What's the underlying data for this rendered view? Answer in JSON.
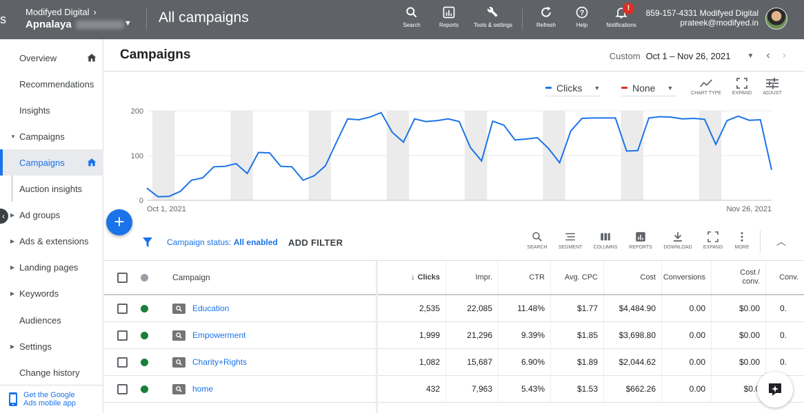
{
  "topbar": {
    "account_line1": "Modifyed Digital",
    "account_line2": "Apnalaya",
    "page_title": "All campaigns",
    "tools": [
      {
        "label": "Search",
        "icon": "search-icon"
      },
      {
        "label": "Reports",
        "icon": "reports-icon"
      },
      {
        "label": "Tools & settings",
        "icon": "wrench-icon"
      },
      {
        "label": "Refresh",
        "icon": "refresh-icon"
      },
      {
        "label": "Help",
        "icon": "help-icon"
      },
      {
        "label": "Notifications",
        "icon": "bell-icon",
        "badge": "!"
      }
    ],
    "user_line1": "859-157-4331 Modifyed Digital",
    "user_line2": "prateek@modifyed.in"
  },
  "sidebar": {
    "items": [
      {
        "label": "Overview"
      },
      {
        "label": "Recommendations"
      },
      {
        "label": "Insights"
      },
      {
        "label": "Campaigns"
      },
      {
        "label": "Campaigns"
      },
      {
        "label": "Auction insights"
      },
      {
        "label": "Ad groups"
      },
      {
        "label": "Ads & extensions"
      },
      {
        "label": "Landing pages"
      },
      {
        "label": "Keywords"
      },
      {
        "label": "Audiences"
      },
      {
        "label": "Settings"
      },
      {
        "label": "Change history"
      }
    ],
    "mobile_app_line1": "Get the Google",
    "mobile_app_line2": "Ads mobile app"
  },
  "main": {
    "title": "Campaigns",
    "date_custom": "Custom",
    "date_range": "Oct 1 – Nov 26, 2021",
    "metric1": "Clicks",
    "metric2": "None",
    "chart_tools": [
      {
        "label": "CHART TYPE"
      },
      {
        "label": "EXPAND"
      },
      {
        "label": "ADJUST"
      }
    ],
    "filter_label": "Campaign status:",
    "filter_value": "All enabled",
    "add_filter": "ADD FILTER",
    "table_tools": [
      {
        "label": "SEARCH"
      },
      {
        "label": "SEGMENT"
      },
      {
        "label": "COLUMNS"
      },
      {
        "label": "REPORTS"
      },
      {
        "label": "DOWNLOAD"
      },
      {
        "label": "EXPAND"
      },
      {
        "label": "MORE"
      }
    ]
  },
  "colors": {
    "accent": "#1a73e8",
    "metric2": "#d93025",
    "enabled": "#188038",
    "topbar": "#5f6368"
  },
  "table": {
    "headers": {
      "campaign": "Campaign",
      "clicks": "Clicks",
      "impr": "Impr.",
      "ctr": "CTR",
      "avg_cpc": "Avg. CPC",
      "cost": "Cost",
      "conversions": "Conversions",
      "cost_conv_1": "Cost /",
      "cost_conv_2": "conv.",
      "conv": "Conv."
    },
    "rows": [
      {
        "campaign": "Education",
        "clicks": "2,535",
        "impr": "22,085",
        "ctr": "11.48%",
        "avg_cpc": "$1.77",
        "cost": "$4,484.90",
        "conversions": "0.00",
        "cost_conv": "$0.00",
        "conv": "0."
      },
      {
        "campaign": "Empowerment",
        "clicks": "1,999",
        "impr": "21,296",
        "ctr": "9.39%",
        "avg_cpc": "$1.85",
        "cost": "$3,698.80",
        "conversions": "0.00",
        "cost_conv": "$0.00",
        "conv": "0."
      },
      {
        "campaign": "Charity+Rights",
        "clicks": "1,082",
        "impr": "15,687",
        "ctr": "6.90%",
        "avg_cpc": "$1.89",
        "cost": "$2,044.62",
        "conversions": "0.00",
        "cost_conv": "$0.00",
        "conv": "0."
      },
      {
        "campaign": "home",
        "clicks": "432",
        "impr": "7,963",
        "ctr": "5.43%",
        "avg_cpc": "$1.53",
        "cost": "$662.26",
        "conversions": "0.00",
        "cost_conv": "$0.0",
        "conv": "0."
      }
    ]
  },
  "chart_data": {
    "type": "line",
    "x_start_label": "Oct 1, 2021",
    "x_end_label": "Nov 26, 2021",
    "y_ticks": [
      "0",
      "100",
      "200"
    ],
    "ylim": [
      0,
      200
    ],
    "grid": true,
    "series": [
      {
        "name": "Clicks",
        "values": [
          27,
          8,
          9,
          20,
          45,
          50,
          75,
          76,
          82,
          60,
          107,
          106,
          76,
          75,
          45,
          55,
          77,
          130,
          182,
          180,
          186,
          196,
          152,
          130,
          182,
          176,
          178,
          182,
          176,
          118,
          88,
          177,
          168,
          135,
          137,
          140,
          116,
          84,
          155,
          183,
          184,
          184,
          184,
          110,
          111,
          184,
          187,
          186,
          182,
          183,
          181,
          125,
          178,
          188,
          179,
          180,
          68
        ]
      }
    ]
  }
}
